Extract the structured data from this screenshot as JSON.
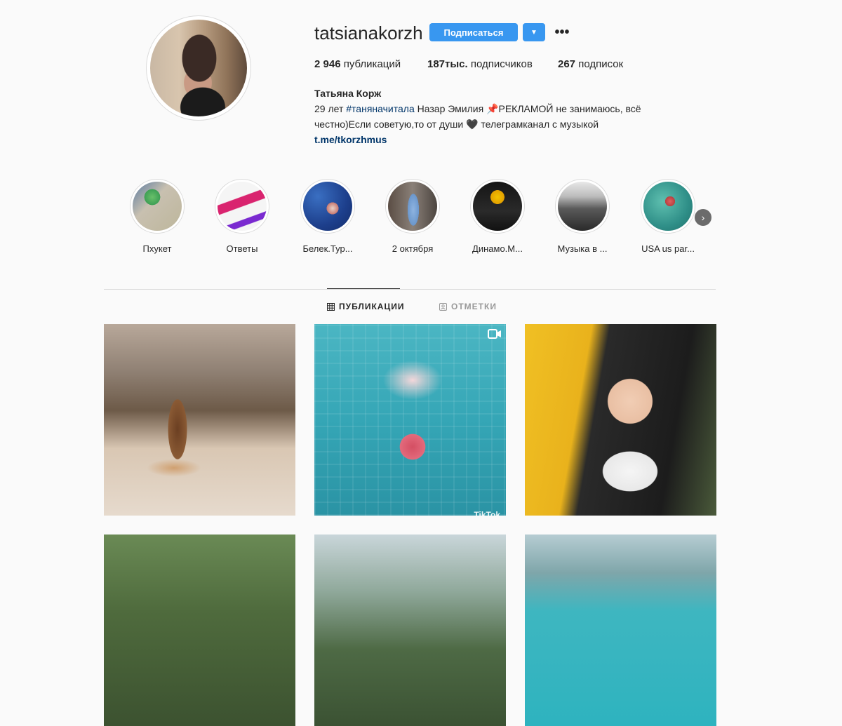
{
  "profile": {
    "username": "tatsianakorzh",
    "follow_label": "Подписаться",
    "more_label": "•••",
    "stats": {
      "posts_count": "2 946",
      "posts_label": "публикаций",
      "followers_count": "187тыс.",
      "followers_label": "подписчиков",
      "following_count": "267",
      "following_label": "подписок"
    },
    "full_name": "Татьяна Корж",
    "bio_line1_prefix": "29 лет",
    "bio_hashtag": "#таняначитала",
    "bio_line1_suffix": "   Назар    Эмилия 📌РЕКЛАМОЙ не занимаюсь, всё",
    "bio_line2": "честно)Если советую,то от души 🖤 телеграмканал с музыкой",
    "bio_link": "t.me/tkorzhmus"
  },
  "highlights": [
    {
      "label": "Пхукет"
    },
    {
      "label": "Ответы"
    },
    {
      "label": "Белек.Тур..."
    },
    {
      "label": "2 октября"
    },
    {
      "label": "Динамо.М..."
    },
    {
      "label": "Музыка в ..."
    },
    {
      "label": "USA us par..."
    }
  ],
  "tabs": {
    "posts": "ПУБЛИКАЦИИ",
    "tagged": "ОТМЕТКИ"
  },
  "posts": {
    "tiktok_label": "TikTok"
  },
  "colors": {
    "accent": "#3897f0",
    "link": "#003569",
    "background": "#fafafa"
  }
}
